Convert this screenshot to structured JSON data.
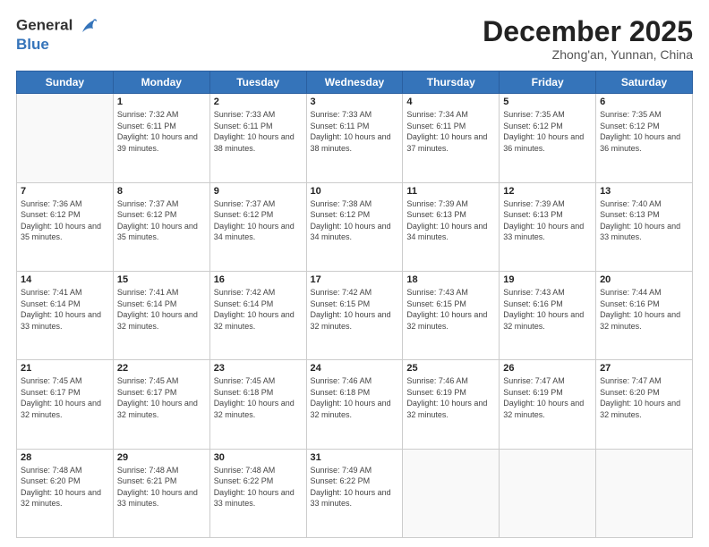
{
  "header": {
    "logo_line1": "General",
    "logo_line2": "Blue",
    "month_title": "December 2025",
    "subtitle": "Zhong'an, Yunnan, China"
  },
  "days_of_week": [
    "Sunday",
    "Monday",
    "Tuesday",
    "Wednesday",
    "Thursday",
    "Friday",
    "Saturday"
  ],
  "weeks": [
    [
      {
        "day": "",
        "info": ""
      },
      {
        "day": "1",
        "info": "Sunrise: 7:32 AM\nSunset: 6:11 PM\nDaylight: 10 hours and 39 minutes."
      },
      {
        "day": "2",
        "info": "Sunrise: 7:33 AM\nSunset: 6:11 PM\nDaylight: 10 hours and 38 minutes."
      },
      {
        "day": "3",
        "info": "Sunrise: 7:33 AM\nSunset: 6:11 PM\nDaylight: 10 hours and 38 minutes."
      },
      {
        "day": "4",
        "info": "Sunrise: 7:34 AM\nSunset: 6:11 PM\nDaylight: 10 hours and 37 minutes."
      },
      {
        "day": "5",
        "info": "Sunrise: 7:35 AM\nSunset: 6:12 PM\nDaylight: 10 hours and 36 minutes."
      },
      {
        "day": "6",
        "info": "Sunrise: 7:35 AM\nSunset: 6:12 PM\nDaylight: 10 hours and 36 minutes."
      }
    ],
    [
      {
        "day": "7",
        "info": "Sunrise: 7:36 AM\nSunset: 6:12 PM\nDaylight: 10 hours and 35 minutes."
      },
      {
        "day": "8",
        "info": "Sunrise: 7:37 AM\nSunset: 6:12 PM\nDaylight: 10 hours and 35 minutes."
      },
      {
        "day": "9",
        "info": "Sunrise: 7:37 AM\nSunset: 6:12 PM\nDaylight: 10 hours and 34 minutes."
      },
      {
        "day": "10",
        "info": "Sunrise: 7:38 AM\nSunset: 6:12 PM\nDaylight: 10 hours and 34 minutes."
      },
      {
        "day": "11",
        "info": "Sunrise: 7:39 AM\nSunset: 6:13 PM\nDaylight: 10 hours and 34 minutes."
      },
      {
        "day": "12",
        "info": "Sunrise: 7:39 AM\nSunset: 6:13 PM\nDaylight: 10 hours and 33 minutes."
      },
      {
        "day": "13",
        "info": "Sunrise: 7:40 AM\nSunset: 6:13 PM\nDaylight: 10 hours and 33 minutes."
      }
    ],
    [
      {
        "day": "14",
        "info": "Sunrise: 7:41 AM\nSunset: 6:14 PM\nDaylight: 10 hours and 33 minutes."
      },
      {
        "day": "15",
        "info": "Sunrise: 7:41 AM\nSunset: 6:14 PM\nDaylight: 10 hours and 32 minutes."
      },
      {
        "day": "16",
        "info": "Sunrise: 7:42 AM\nSunset: 6:14 PM\nDaylight: 10 hours and 32 minutes."
      },
      {
        "day": "17",
        "info": "Sunrise: 7:42 AM\nSunset: 6:15 PM\nDaylight: 10 hours and 32 minutes."
      },
      {
        "day": "18",
        "info": "Sunrise: 7:43 AM\nSunset: 6:15 PM\nDaylight: 10 hours and 32 minutes."
      },
      {
        "day": "19",
        "info": "Sunrise: 7:43 AM\nSunset: 6:16 PM\nDaylight: 10 hours and 32 minutes."
      },
      {
        "day": "20",
        "info": "Sunrise: 7:44 AM\nSunset: 6:16 PM\nDaylight: 10 hours and 32 minutes."
      }
    ],
    [
      {
        "day": "21",
        "info": "Sunrise: 7:45 AM\nSunset: 6:17 PM\nDaylight: 10 hours and 32 minutes."
      },
      {
        "day": "22",
        "info": "Sunrise: 7:45 AM\nSunset: 6:17 PM\nDaylight: 10 hours and 32 minutes."
      },
      {
        "day": "23",
        "info": "Sunrise: 7:45 AM\nSunset: 6:18 PM\nDaylight: 10 hours and 32 minutes."
      },
      {
        "day": "24",
        "info": "Sunrise: 7:46 AM\nSunset: 6:18 PM\nDaylight: 10 hours and 32 minutes."
      },
      {
        "day": "25",
        "info": "Sunrise: 7:46 AM\nSunset: 6:19 PM\nDaylight: 10 hours and 32 minutes."
      },
      {
        "day": "26",
        "info": "Sunrise: 7:47 AM\nSunset: 6:19 PM\nDaylight: 10 hours and 32 minutes."
      },
      {
        "day": "27",
        "info": "Sunrise: 7:47 AM\nSunset: 6:20 PM\nDaylight: 10 hours and 32 minutes."
      }
    ],
    [
      {
        "day": "28",
        "info": "Sunrise: 7:48 AM\nSunset: 6:20 PM\nDaylight: 10 hours and 32 minutes."
      },
      {
        "day": "29",
        "info": "Sunrise: 7:48 AM\nSunset: 6:21 PM\nDaylight: 10 hours and 33 minutes."
      },
      {
        "day": "30",
        "info": "Sunrise: 7:48 AM\nSunset: 6:22 PM\nDaylight: 10 hours and 33 minutes."
      },
      {
        "day": "31",
        "info": "Sunrise: 7:49 AM\nSunset: 6:22 PM\nDaylight: 10 hours and 33 minutes."
      },
      {
        "day": "",
        "info": ""
      },
      {
        "day": "",
        "info": ""
      },
      {
        "day": "",
        "info": ""
      }
    ]
  ]
}
